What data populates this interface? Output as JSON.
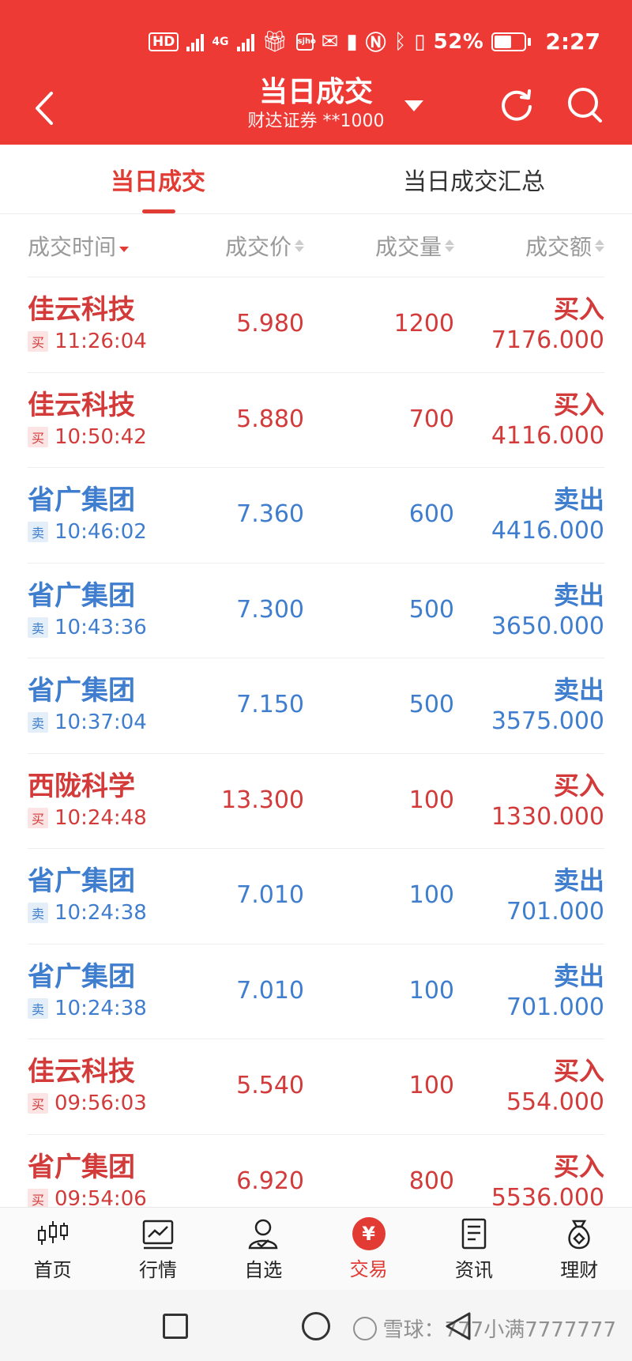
{
  "status_bar": {
    "hd_label": "HD",
    "network_label": "4G",
    "app_icon_label": "sjho",
    "battery": "52%",
    "battery_level": 0.52,
    "time": "2:27"
  },
  "header": {
    "title": "当日成交",
    "subtitle": "财达证券 **1000",
    "back_icon": "chevron-left-icon",
    "dropdown_icon": "caret-down-icon",
    "refresh_icon": "refresh-icon",
    "search_icon": "search-icon"
  },
  "tabs": [
    {
      "label": "当日成交",
      "active": true
    },
    {
      "label": "当日成交汇总",
      "active": false
    }
  ],
  "columns": {
    "time": "成交时间",
    "price": "成交价",
    "volume": "成交量",
    "amount": "成交额"
  },
  "trades": [
    {
      "name": "佳云科技",
      "side": "买",
      "time": "11:26:04",
      "price": "5.980",
      "volume": "1200",
      "direction": "买入",
      "amount": "7176.000"
    },
    {
      "name": "佳云科技",
      "side": "买",
      "time": "10:50:42",
      "price": "5.880",
      "volume": "700",
      "direction": "买入",
      "amount": "4116.000"
    },
    {
      "name": "省广集团",
      "side": "卖",
      "time": "10:46:02",
      "price": "7.360",
      "volume": "600",
      "direction": "卖出",
      "amount": "4416.000"
    },
    {
      "name": "省广集团",
      "side": "卖",
      "time": "10:43:36",
      "price": "7.300",
      "volume": "500",
      "direction": "卖出",
      "amount": "3650.000"
    },
    {
      "name": "省广集团",
      "side": "卖",
      "time": "10:37:04",
      "price": "7.150",
      "volume": "500",
      "direction": "卖出",
      "amount": "3575.000"
    },
    {
      "name": "西陇科学",
      "side": "买",
      "time": "10:24:48",
      "price": "13.300",
      "volume": "100",
      "direction": "买入",
      "amount": "1330.000"
    },
    {
      "name": "省广集团",
      "side": "卖",
      "time": "10:24:38",
      "price": "7.010",
      "volume": "100",
      "direction": "卖出",
      "amount": "701.000"
    },
    {
      "name": "省广集团",
      "side": "卖",
      "time": "10:24:38",
      "price": "7.010",
      "volume": "100",
      "direction": "卖出",
      "amount": "701.000"
    },
    {
      "name": "佳云科技",
      "side": "买",
      "time": "09:56:03",
      "price": "5.540",
      "volume": "100",
      "direction": "买入",
      "amount": "554.000"
    },
    {
      "name": "省广集团",
      "side": "买",
      "time": "09:54:06",
      "price": "6.920",
      "volume": "800",
      "direction": "买入",
      "amount": "5536.000"
    }
  ],
  "bottom_nav": [
    {
      "label": "首页",
      "icon": "candlestick-icon",
      "active": false
    },
    {
      "label": "行情",
      "icon": "chart-line-icon",
      "active": false
    },
    {
      "label": "自选",
      "icon": "user-check-icon",
      "active": false
    },
    {
      "label": "交易",
      "icon": "yuan-icon",
      "glyph": "¥",
      "active": true
    },
    {
      "label": "资讯",
      "icon": "document-icon",
      "active": false
    },
    {
      "label": "理财",
      "icon": "money-bag-icon",
      "active": false
    }
  ],
  "watermark": "雪球：777小满7777777",
  "colors": {
    "brand_red": "#ee3a35",
    "buy_red": "#d33a3a",
    "sell_blue": "#3f7ecf",
    "muted_gray": "#999999"
  }
}
